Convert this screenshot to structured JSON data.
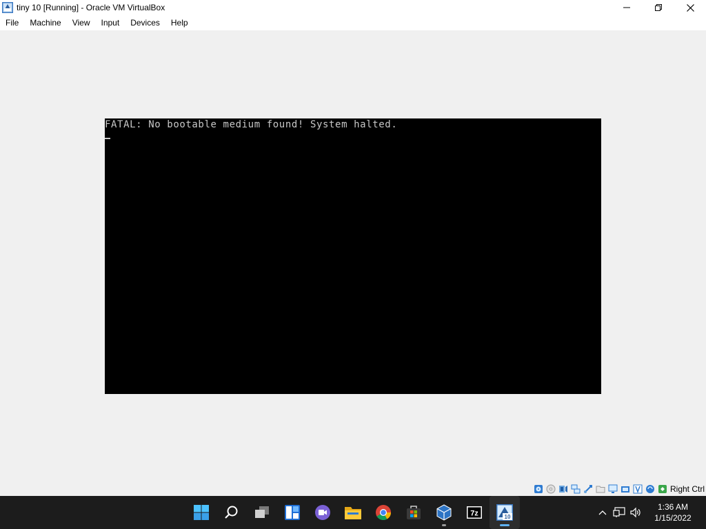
{
  "window": {
    "title": "tiny 10 [Running] - Oracle VM VirtualBox",
    "controls": {
      "minimize": "minimize-icon",
      "restore": "restore-icon",
      "close": "close-icon"
    }
  },
  "menu": {
    "items": [
      {
        "label": "File"
      },
      {
        "label": "Machine"
      },
      {
        "label": "View"
      },
      {
        "label": "Input"
      },
      {
        "label": "Devices"
      },
      {
        "label": "Help"
      }
    ]
  },
  "guest": {
    "message": "FATAL: No bootable medium found! System halted.",
    "background": "#000000",
    "text_color": "#c8c8c8"
  },
  "statusbar": {
    "icons": [
      "hard-disk-icon",
      "optical-drive-icon",
      "audio-icon",
      "network-icon",
      "usb-icon",
      "shared-folders-icon",
      "display-icon",
      "video-capture-icon",
      "recording-icon",
      "mouse-integration-icon",
      "host-key-icon"
    ],
    "host_key": "Right Ctrl"
  },
  "taskbar": {
    "apps": [
      "start-icon",
      "search-icon",
      "task-view-icon",
      "widgets-icon",
      "chat-icon",
      "file-explorer-icon",
      "chrome-icon",
      "microsoft-store-icon",
      "virtualbox-icon",
      "7zip-icon",
      "virtualbox-vm-icon"
    ],
    "time": "1:36 AM",
    "date": "1/15/2022",
    "accent": "#5fb2f2"
  }
}
